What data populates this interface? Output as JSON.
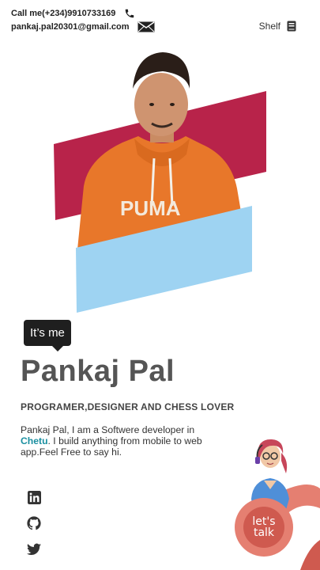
{
  "header": {
    "phone_text": "Call me(+234)9910733169",
    "email_text": "pankaj.pal20301@gmail.com",
    "shelf_label": "Shelf"
  },
  "hero": {
    "tooltip": "It’s me",
    "shirt_brand": "PUMA"
  },
  "profile": {
    "name": "Pankaj Pal",
    "tagline": "PROGRAMER,DESIGNER AND CHESS LOVER",
    "bio_part1": "Pankaj Pal, I am a Softwere developer in",
    "bio_company": "Chetu",
    "bio_part2": ". I build anything from mobile to web app.Feel Free to say hi."
  },
  "cta": {
    "line1": "let's",
    "line2": "talk"
  },
  "colors": {
    "maroon_band": "#b8234a",
    "blue_band": "#9ed3f2",
    "accent_company": "#1a8fa0",
    "talk_circle": "#e57f71",
    "talk_inner": "#cf5a4f"
  },
  "icons": [
    "phone-icon",
    "mail-icon",
    "book-icon",
    "linkedin-icon",
    "github-icon",
    "twitter-icon"
  ]
}
